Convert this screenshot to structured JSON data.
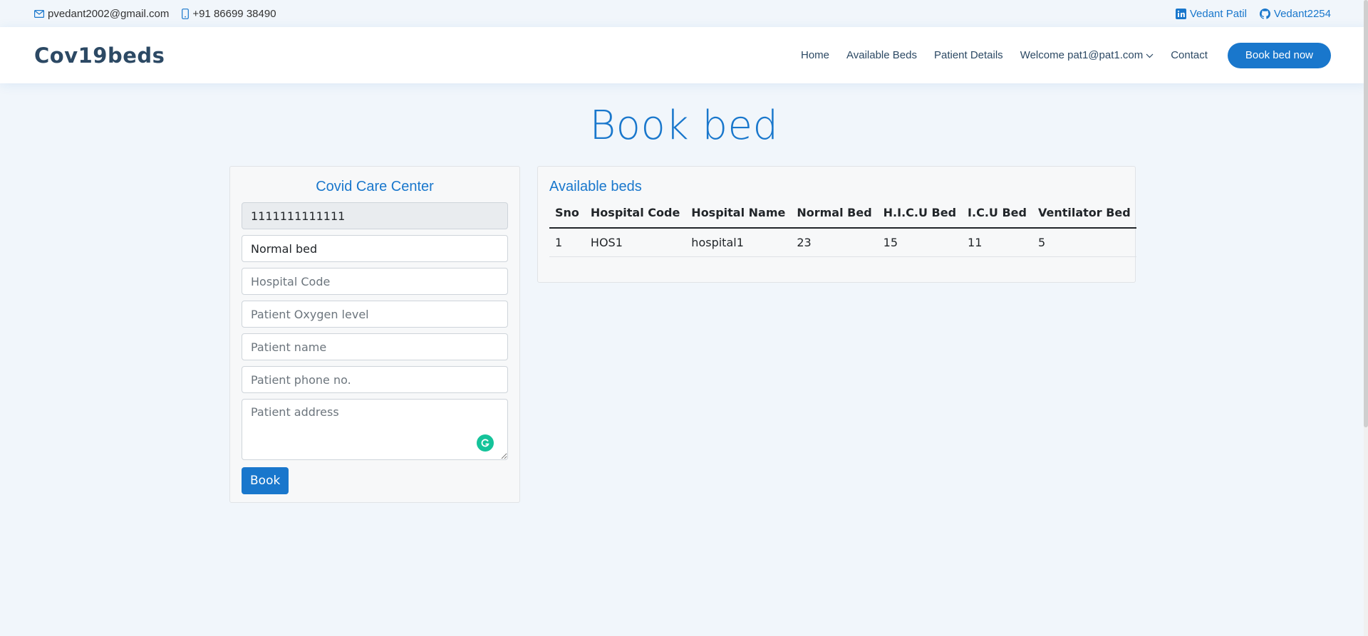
{
  "topbar": {
    "email": "pvedant2002@gmail.com",
    "phone": "+91 86699 38490",
    "linkedin": "Vedant Patil",
    "github": "Vedant2254"
  },
  "header": {
    "logo": "Cov19beds",
    "nav": [
      "Home",
      "Available Beds",
      "Patient Details",
      "Welcome pat1@pat1.com",
      "Contact"
    ],
    "cta": "Book bed now"
  },
  "page": {
    "title": "Book bed"
  },
  "form": {
    "title": "Covid Care Center",
    "srf_value": "1111111111111",
    "bed_type_selected": "Normal bed",
    "hospital_code_placeholder": "Hospital Code",
    "oxygen_placeholder": "Patient Oxygen level",
    "name_placeholder": "Patient name",
    "phone_placeholder": "Patient phone no.",
    "address_placeholder": "Patient address",
    "submit_label": "Book"
  },
  "beds": {
    "title": "Available beds",
    "columns": [
      "Sno",
      "Hospital Code",
      "Hospital Name",
      "Normal Bed",
      "H.I.C.U Bed",
      "I.C.U Bed",
      "Ventilator Bed"
    ],
    "rows": [
      [
        "1",
        "HOS1",
        "hospital1",
        "23",
        "15",
        "11",
        "5"
      ]
    ]
  },
  "colors": {
    "accent": "#1977cc",
    "heading": "#2c4964",
    "background": "#f1f6fb"
  }
}
